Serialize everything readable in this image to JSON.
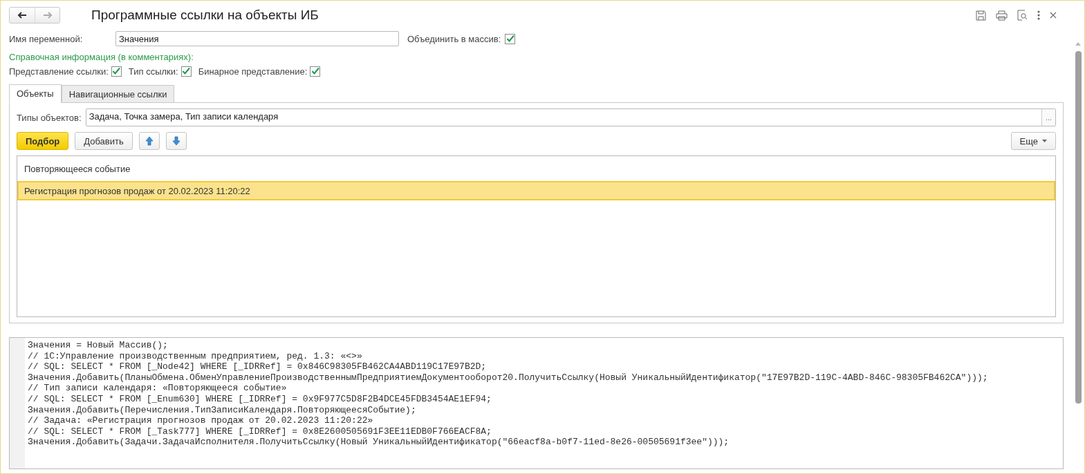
{
  "window": {
    "title": "Программные ссылки на объекты ИБ"
  },
  "variable": {
    "label": "Имя переменной:",
    "value": "Значения"
  },
  "merge_array": {
    "label": "Объединить в массив:",
    "checked": true
  },
  "reference_info": {
    "title": "Справочная информация (в комментариях):",
    "options": [
      {
        "label": "Представление ссылки:",
        "checked": true
      },
      {
        "label": "Тип ссылки:",
        "checked": true
      },
      {
        "label": "Бинарное представление:",
        "checked": true
      }
    ]
  },
  "tabs": [
    {
      "label": "Объекты",
      "selected": true
    },
    {
      "label": "Навигационные ссылки",
      "selected": false
    }
  ],
  "object_types": {
    "label": "Типы объектов:",
    "value": "Задача, Точка замера, Тип записи календаря",
    "button": "..."
  },
  "toolbar": {
    "pick": "Подбор",
    "add": "Добавить",
    "more": "Еще"
  },
  "table": {
    "rows": [
      {
        "text": "Повторяющееся событие",
        "selected": false
      },
      {
        "text": "Регистрация прогнозов продаж от 20.02.2023 11:20:22",
        "selected": true
      }
    ]
  },
  "code_lines": [
    "Значения = Новый Массив();",
    "// 1С:Управление производственным предприятием, ред. 1.3: «<>»",
    "// SQL: SELECT * FROM [_Node42] WHERE [_IDRRef] = 0x846C98305FB462CA4ABD119C17E97B2D;",
    "Значения.Добавить(ПланыОбмена.ОбменУправлениеПроизводственнымПредприятиемДокументооборот20.ПолучитьСсылку(Новый УникальныйИдентификатор(\"17E97B2D-119C-4ABD-846C-98305FB462CA\")));",
    "// Тип записи календаря: «Повторяющееся событие»",
    "// SQL: SELECT * FROM [_Enum630] WHERE [_IDRRef] = 0x9F977C5D8F2B4DCE45FDB3454AE1EF94;",
    "Значения.Добавить(Перечисления.ТипЗаписиКалендаря.ПовторяющеесяСобытие);",
    "// Задача: «Регистрация прогнозов продаж от 20.02.2023 11:20:22»",
    "// SQL: SELECT * FROM [_Task777] WHERE [_IDRRef] = 0x8E2600505691F3EE11EDB0F766EACF8A;",
    "Значения.Добавить(Задачи.ЗадачаИсполнителя.ПолучитьСсылку(Новый УникальныйИдентификатор(\"66eacf8a-b0f7-11ed-8e26-00505691f3ee\")));"
  ]
}
